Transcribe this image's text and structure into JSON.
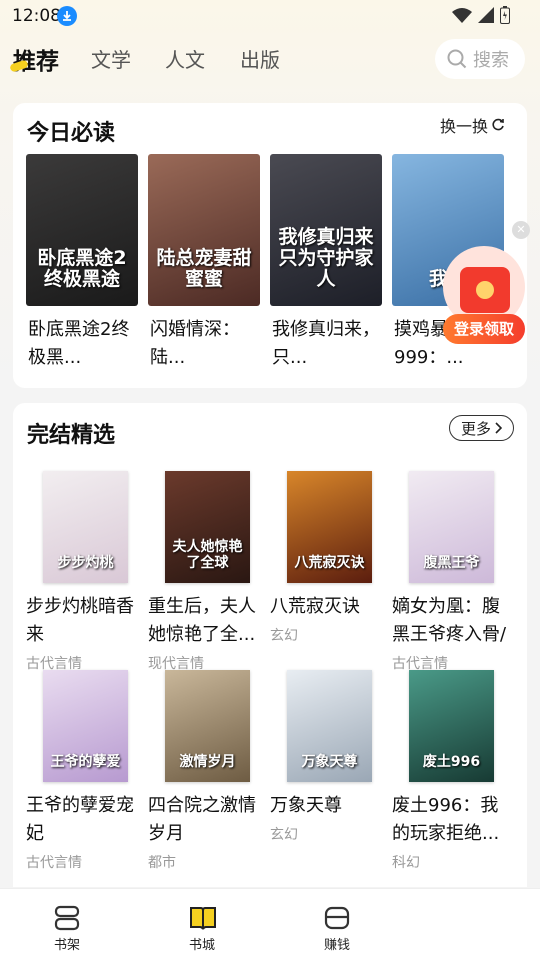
{
  "status_bar": {
    "time": "12:08"
  },
  "nav": {
    "tabs": [
      "推荐",
      "文学",
      "人文",
      "出版"
    ],
    "active_tab": 0,
    "search_placeholder": "搜索"
  },
  "daily": {
    "title": "今日必读",
    "refresh_label": "换一换",
    "books": [
      {
        "name": "卧底黑途2终极黑...",
        "cover_text": "卧底黑途2终极黑途",
        "colors": [
          "#3b3a3a",
          "#1a1a1a"
        ]
      },
      {
        "name": "闪婚情深：陆...",
        "cover_text": "陆总宠妻甜蜜蜜",
        "colors": [
          "#9a6a58",
          "#4c2a24"
        ]
      },
      {
        "name": "我修真归来，只...",
        "cover_text": "我修真归来只为守护家人",
        "colors": [
          "#4a4a52",
          "#1d1f28"
        ]
      },
      {
        "name": "摸鸡暴揍999：...",
        "cover_text": "我躺",
        "colors": [
          "#86b6e0",
          "#3a6fa5"
        ]
      }
    ]
  },
  "finished": {
    "title": "完结精选",
    "more_label": "更多",
    "books": [
      {
        "name": "步步灼桃暗香来",
        "genre": "古代言情",
        "cover_text": "步步灼桃",
        "colors": [
          "#f2eef0",
          "#d9c8d6"
        ]
      },
      {
        "name": "重生后，夫人她惊艳了全...",
        "genre": "现代言情",
        "cover_text": "夫人她惊艳了全球",
        "colors": [
          "#6b3a2c",
          "#2a1712"
        ]
      },
      {
        "name": "八荒寂灭诀",
        "genre": "玄幻",
        "cover_text": "八荒寂灭诀",
        "colors": [
          "#d8862a",
          "#5b1d0e"
        ]
      },
      {
        "name": "嫡女为凰：腹黑王爷疼入骨/",
        "genre": "古代言情",
        "cover_text": "腹黑王爷",
        "colors": [
          "#f1ebf2",
          "#cdb9d9"
        ]
      },
      {
        "name": "王爷的孽爱宠妃",
        "genre": "古代言情",
        "cover_text": "王爷的孽爱",
        "colors": [
          "#e9dcf0",
          "#b79ad0"
        ]
      },
      {
        "name": "四合院之激情岁月",
        "genre": "都市",
        "cover_text": "激情岁月",
        "colors": [
          "#c9b79a",
          "#6e5c43"
        ]
      },
      {
        "name": "万象天尊",
        "genre": "玄幻",
        "cover_text": "万象天尊",
        "colors": [
          "#e8edf2",
          "#9aa7b5"
        ]
      },
      {
        "name": "废土996：我的玩家拒绝...",
        "genre": "科幻",
        "cover_text": "废土996",
        "colors": [
          "#4a9a88",
          "#173a33"
        ]
      }
    ]
  },
  "float_login": {
    "label": "登录领取"
  },
  "bottom_nav": {
    "tabs": [
      "书架",
      "书城",
      "赚钱"
    ],
    "active_tab": 1
  },
  "colors": {
    "accent_yellow": "#f5d020",
    "login_red": "#f53d2d"
  }
}
